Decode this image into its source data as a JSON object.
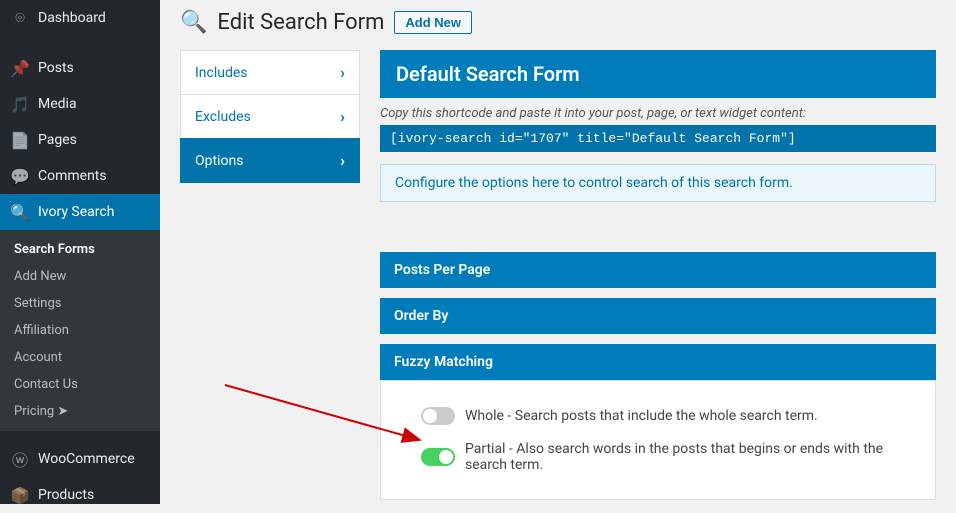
{
  "sidebar": {
    "items": [
      {
        "label": "Dashboard"
      },
      {
        "label": "Posts"
      },
      {
        "label": "Media"
      },
      {
        "label": "Pages"
      },
      {
        "label": "Comments"
      },
      {
        "label": "Ivory Search"
      },
      {
        "label": "WooCommerce"
      },
      {
        "label": "Products"
      }
    ],
    "sub": {
      "search_forms": "Search Forms",
      "add_new": "Add New",
      "settings": "Settings",
      "affiliation": "Affiliation",
      "account": "Account",
      "contact_us": "Contact Us",
      "pricing": "Pricing ➤"
    }
  },
  "heading": {
    "title": "Edit Search Form",
    "add_new": "Add New"
  },
  "tabs": {
    "includes": "Includes",
    "excludes": "Excludes",
    "options": "Options"
  },
  "form": {
    "title": "Default Search Form",
    "shortcode_hint": "Copy this shortcode and paste it into your post, page, or text widget content:",
    "shortcode": "[ivory-search id=\"1707\" title=\"Default Search Form\"]",
    "options_info": "Configure the options here to control search of this search form."
  },
  "sections": {
    "posts_per_page": "Posts Per Page",
    "order_by": "Order By",
    "fuzzy": "Fuzzy Matching"
  },
  "fuzzy": {
    "whole": "Whole - Search posts that include the whole search term.",
    "partial": "Partial - Also search words in the posts that begins or ends with the search term."
  }
}
